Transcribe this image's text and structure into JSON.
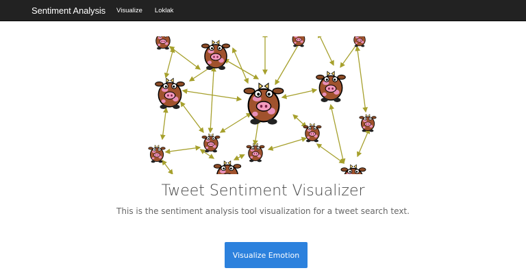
{
  "navbar": {
    "brand": "Sentiment Analysis",
    "links": [
      "Visualize",
      "Loklak"
    ]
  },
  "hero": {
    "title": "Tweet Sentiment Visualizer",
    "subtitle": "This is the sentiment analysis tool visualization for a tweet search text.",
    "button_label": "Visualize Emotion"
  },
  "colors": {
    "navbar_bg": "#222222",
    "button_bg": "#2c81dd",
    "edge": "#a6a02c"
  },
  "graph_icon": "cow-icon"
}
